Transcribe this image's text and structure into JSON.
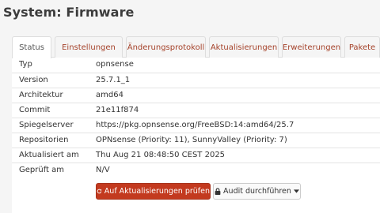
{
  "header": {
    "title": "System: Firmware"
  },
  "tabs": [
    {
      "label": "Status",
      "active": true
    },
    {
      "label": "Einstellungen"
    },
    {
      "label": "Änderungsprotokoll"
    },
    {
      "label": "Aktualisierungen"
    },
    {
      "label": "Erweiterungen"
    },
    {
      "label": "Pakete"
    }
  ],
  "info_rows": [
    {
      "key": "Typ",
      "value": "opnsense"
    },
    {
      "key": "Version",
      "value": "25.7.1_1"
    },
    {
      "key": "Architektur",
      "value": "amd64"
    },
    {
      "key": "Commit",
      "value": "21e11f874"
    },
    {
      "key": "Spiegelserver",
      "value": "https://pkg.opnsense.org/FreeBSD:14:amd64/25.7"
    },
    {
      "key": "Repositorien",
      "value": "OPNsense (Priority: 11), SunnyValley (Priority: 7)"
    },
    {
      "key": "Aktualisiert am",
      "value": "Thu Aug 21 08:48:50 CEST 2025"
    },
    {
      "key": "Geprüft am",
      "value": "N/V"
    }
  ],
  "actions": {
    "check_updates_label": "Auf Aktualisierungen prüfen",
    "audit_label": "Audit durchführen"
  },
  "colors": {
    "accent": "#c33a1f",
    "tab_text": "#a5422a"
  }
}
